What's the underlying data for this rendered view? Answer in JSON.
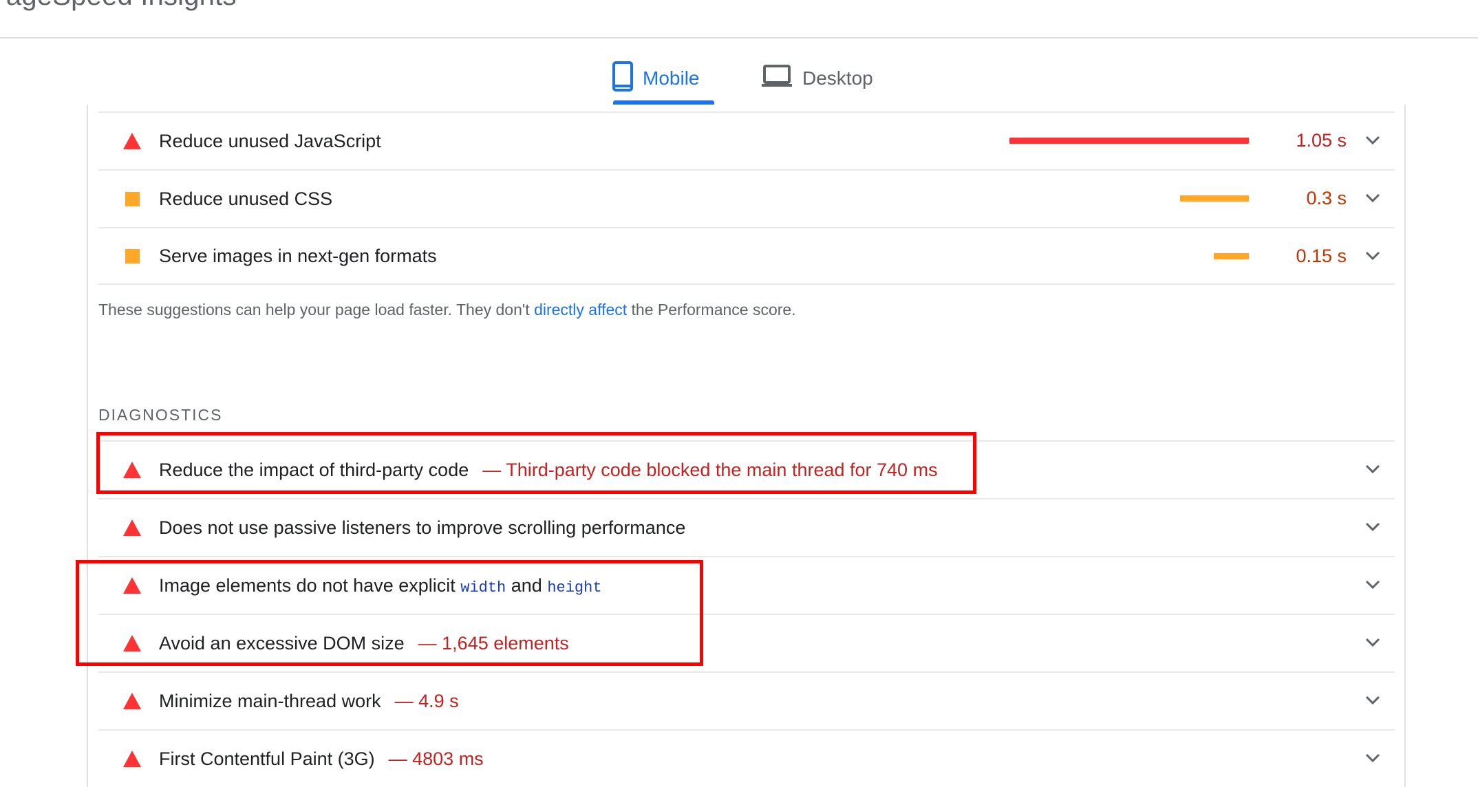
{
  "header": {
    "title": "PageSpeed Insights"
  },
  "tabs": [
    {
      "label": "Mobile",
      "icon": "phone-icon",
      "active": true
    },
    {
      "label": "Desktop",
      "icon": "laptop-icon",
      "active": false
    }
  ],
  "opportunities": [
    {
      "title": "Reduce unused JavaScript",
      "severity": "fail",
      "value": "1.05 s",
      "bar_fraction": 1.0
    },
    {
      "title": "Reduce unused CSS",
      "severity": "average",
      "value": "0.3 s",
      "bar_fraction": 0.29
    },
    {
      "title": "Serve images in next-gen formats",
      "severity": "average",
      "value": "0.15 s",
      "bar_fraction": 0.14
    }
  ],
  "note": {
    "before": "These suggestions can help your page load faster. They don't ",
    "link": "directly affect",
    "after": " the Performance score."
  },
  "diagnostics": {
    "heading": "DIAGNOSTICS",
    "items": [
      {
        "title": "Reduce the impact of third-party code",
        "detail": "— Third-party code blocked the main thread for 740 ms"
      },
      {
        "title": "Does not use passive listeners to improve scrolling performance"
      },
      {
        "title_before": "Image elements do not have explicit ",
        "code1": "width",
        "title_mid": " and ",
        "code2": "height"
      },
      {
        "title": "Avoid an excessive DOM size",
        "detail": "— 1,645 elements"
      },
      {
        "title": "Minimize main-thread work",
        "detail": "— 4.9 s"
      },
      {
        "title": "First Contentful Paint (3G)",
        "detail": "— 4803 ms"
      }
    ]
  },
  "colors": {
    "accent": "#1a73e8",
    "fail": "#ff3333",
    "average": "#ffa726",
    "fail_text": "#c5221f",
    "highlight_box": "#ff0000"
  }
}
